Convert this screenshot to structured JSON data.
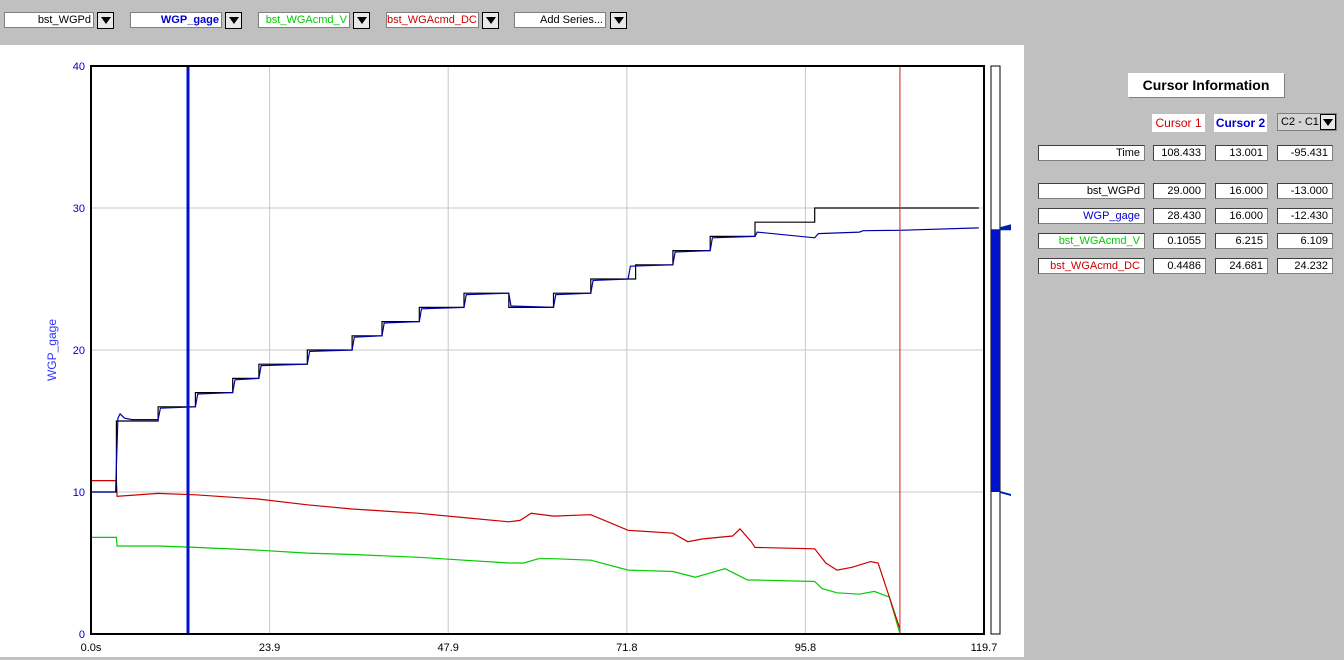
{
  "toolbar": {
    "series": [
      {
        "label": "bst_WGPd",
        "color": "#000000",
        "bold": false
      },
      {
        "label": "WGP_gage",
        "color": "#0000cc",
        "bold": true
      },
      {
        "label": "bst_WGAcmd_V",
        "color": "#00cc00",
        "bold": false
      },
      {
        "label": "bst_WGAcmd_DC",
        "color": "#cc0000",
        "bold": false
      },
      {
        "label": "Add Series...",
        "color": "#000000",
        "bold": false
      }
    ],
    "dropdown_icon": "chevron-down-icon"
  },
  "chart_data": {
    "type": "line",
    "ylabel": "WGP_gage",
    "xlabel": "",
    "xlim": [
      0,
      119.7
    ],
    "ylim": [
      0,
      40
    ],
    "x_ticks": [
      "0.0s",
      "23.9",
      "47.9",
      "71.8",
      "95.8",
      "119.7"
    ],
    "y_ticks": [
      "0",
      "10",
      "20",
      "30",
      "40"
    ],
    "grid": true,
    "cursor1_x": 108.433,
    "cursor2_x": 13.001,
    "series": [
      {
        "name": "bst_WGPd",
        "color": "#000000",
        "x": [
          0,
          3.4,
          3.4,
          9,
          9,
          14,
          14,
          19,
          19,
          22.5,
          22.5,
          29,
          29,
          35,
          35,
          39,
          39,
          44,
          44,
          50,
          50,
          56,
          56,
          62,
          62,
          67,
          67,
          73,
          73,
          78,
          78,
          83,
          83,
          89,
          89,
          97,
          97,
          103,
          103,
          106,
          106,
          111,
          111,
          119
        ],
        "values": [
          10,
          10,
          15,
          15,
          16,
          16,
          17,
          17,
          18,
          18,
          19,
          19,
          20,
          20,
          21,
          21,
          22,
          22,
          23,
          23,
          24,
          24,
          23,
          23,
          24,
          24,
          25,
          25,
          26,
          26,
          27,
          27,
          28,
          28,
          29,
          29,
          30,
          30,
          30,
          30,
          30,
          30,
          30,
          30
        ]
      },
      {
        "name": "WGP_gage",
        "color": "#0000aa",
        "x": [
          0,
          3.3,
          3.6,
          3.9,
          4.5,
          5.5,
          9,
          9.3,
          14,
          14.3,
          19,
          19.3,
          22.5,
          22.8,
          29,
          29.3,
          35,
          35.3,
          39,
          39.3,
          44,
          44.3,
          50,
          50.3,
          56,
          56.3,
          62,
          62.3,
          67,
          67.3,
          72,
          72.3,
          78,
          78.3,
          83,
          83.3,
          89,
          89.3,
          97,
          97.5,
          103,
          103.5,
          108.4,
          119
        ],
        "values": [
          10,
          10,
          15.2,
          15.5,
          15.2,
          15.1,
          15.1,
          15.9,
          16,
          16.9,
          17,
          17.9,
          18,
          18.9,
          19,
          19.9,
          20,
          20.9,
          21,
          21.9,
          22,
          22.9,
          23,
          23.9,
          24,
          23.1,
          23,
          23.9,
          24,
          24.9,
          25,
          25.9,
          26,
          26.9,
          27,
          27.9,
          28,
          28.3,
          27.9,
          28.2,
          28.3,
          28.4,
          28.43,
          28.6
        ]
      },
      {
        "name": "bst_WGAcmd_V",
        "color": "#00cc00",
        "x": [
          0,
          3.4,
          3.5,
          9,
          14,
          22.5,
          29,
          35,
          44,
          50,
          56,
          58,
          60,
          62,
          67,
          72,
          78,
          81,
          83,
          85,
          88,
          89,
          97,
          98,
          100,
          103,
          105,
          107,
          108.4
        ],
        "values": [
          6.8,
          6.8,
          6.2,
          6.2,
          6.1,
          5.9,
          5.7,
          5.6,
          5.4,
          5.2,
          5.0,
          5.0,
          5.3,
          5.3,
          5.2,
          4.5,
          4.4,
          4.0,
          4.3,
          4.6,
          3.8,
          3.8,
          3.7,
          3.2,
          2.9,
          2.8,
          3.0,
          2.6,
          0.1
        ]
      },
      {
        "name": "bst_WGAcmd_DC",
        "color": "#cc0000",
        "x": [
          0,
          3.4,
          3.5,
          9,
          14,
          22.5,
          29,
          35,
          44,
          50,
          56,
          57.5,
          59,
          62,
          67,
          72,
          78,
          80,
          82,
          86,
          87,
          88.5,
          89,
          97,
          98.5,
          100,
          102,
          104.5,
          105.5,
          108.4
        ],
        "values": [
          10.8,
          10.8,
          9.7,
          9.9,
          9.8,
          9.5,
          9.1,
          8.8,
          8.5,
          8.2,
          7.9,
          8.0,
          8.5,
          8.3,
          8.4,
          7.3,
          7.1,
          6.5,
          6.7,
          6.9,
          7.4,
          6.5,
          6.1,
          6.0,
          5.0,
          4.5,
          4.7,
          5.1,
          5.0,
          0.4
        ]
      }
    ]
  },
  "cursor_info": {
    "title": "Cursor Information",
    "cursor1_label": "Cursor 1",
    "cursor2_label": "Cursor 2",
    "diff_select": "C2 - C1",
    "time_row": {
      "label": "Time",
      "c1": "108.433",
      "c2": "13.001",
      "diff": "-95.431"
    },
    "rows": [
      {
        "label": "bst_WGPd",
        "color": "#000000",
        "c1": "29.000",
        "c2": "16.000",
        "diff": "-13.000"
      },
      {
        "label": "WGP_gage",
        "color": "#0000cc",
        "c1": "28.430",
        "c2": "16.000",
        "diff": "-12.430"
      },
      {
        "label": "bst_WGAcmd_V",
        "color": "#00cc00",
        "c1": "0.1055",
        "c2": "6.215",
        "diff": "6.109"
      },
      {
        "label": "bst_WGAcmd_DC",
        "color": "#cc0000",
        "c1": "0.4486",
        "c2": "24.681",
        "diff": "24.232"
      }
    ]
  },
  "scrollbar": {
    "range_low": 10,
    "range_high": 28.5
  }
}
